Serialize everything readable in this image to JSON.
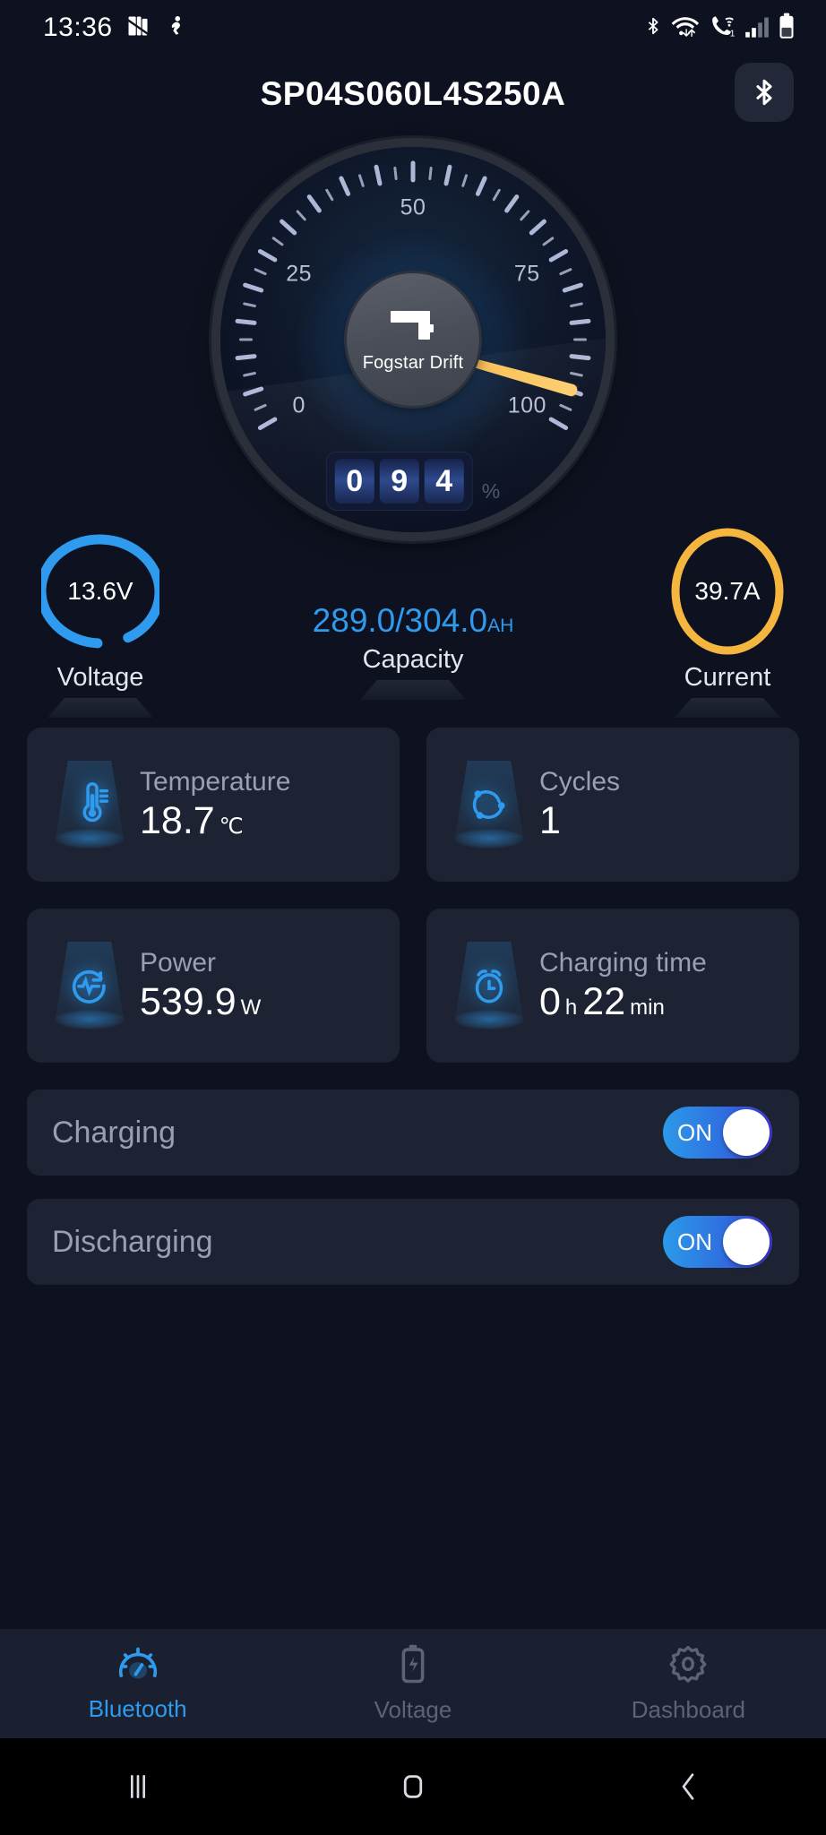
{
  "statusbar": {
    "time": "13:36",
    "left_icons": [
      "antivirus-icon",
      "fitness-icon"
    ],
    "right_icons": [
      "bluetooth-icon",
      "wifi-data-icon",
      "wifi-calling-icon",
      "signal-icon",
      "battery-icon"
    ]
  },
  "header": {
    "title": "SP04S060L4S250A",
    "bluetooth_button_icon": "bluetooth-icon"
  },
  "gauge": {
    "brand": "Fogstar Drift",
    "logo_icon": "fogstar-f-logo",
    "min": 0,
    "max": 100,
    "value": 94,
    "unit": "%",
    "tick_labels": [
      "0",
      "25",
      "50",
      "75",
      "100"
    ],
    "digits": [
      "0",
      "9",
      "4"
    ],
    "needle_color": "#fbc55f",
    "accent_color": "#2e9bef"
  },
  "readouts": {
    "voltage": {
      "value": "13.6V",
      "label": "Voltage",
      "color": "#2e9bef",
      "percent": 92
    },
    "capacity": {
      "value": "289.0/304.0",
      "unit": "AH",
      "label": "Capacity",
      "color": "#2e9bef"
    },
    "current": {
      "value": "39.7A",
      "label": "Current",
      "color": "#f5b63f",
      "percent": 100
    }
  },
  "metrics": [
    {
      "label": "Temperature",
      "value": "18.7",
      "unit": "℃",
      "icon": "thermometer-icon"
    },
    {
      "label": "Cycles",
      "value": "1",
      "unit": "",
      "icon": "cycles-icon"
    },
    {
      "label": "Power",
      "value": "539.9",
      "unit": "W",
      "icon": "power-pulse-icon"
    },
    {
      "label": "Charging time",
      "value": "0",
      "unit": "h",
      "value2": "22",
      "unit2": "min",
      "icon": "alarm-clock-icon"
    }
  ],
  "switches": [
    {
      "label": "Charging",
      "state": "ON"
    },
    {
      "label": "Discharging",
      "state": "ON"
    }
  ],
  "bottom_nav": [
    {
      "label": "Bluetooth",
      "icon": "speedometer-icon",
      "active": true
    },
    {
      "label": "Voltage",
      "icon": "battery-bolt-icon",
      "active": false
    },
    {
      "label": "Dashboard",
      "icon": "gear-icon",
      "active": false
    }
  ],
  "android_nav": [
    "recents-icon",
    "home-icon",
    "back-icon"
  ]
}
